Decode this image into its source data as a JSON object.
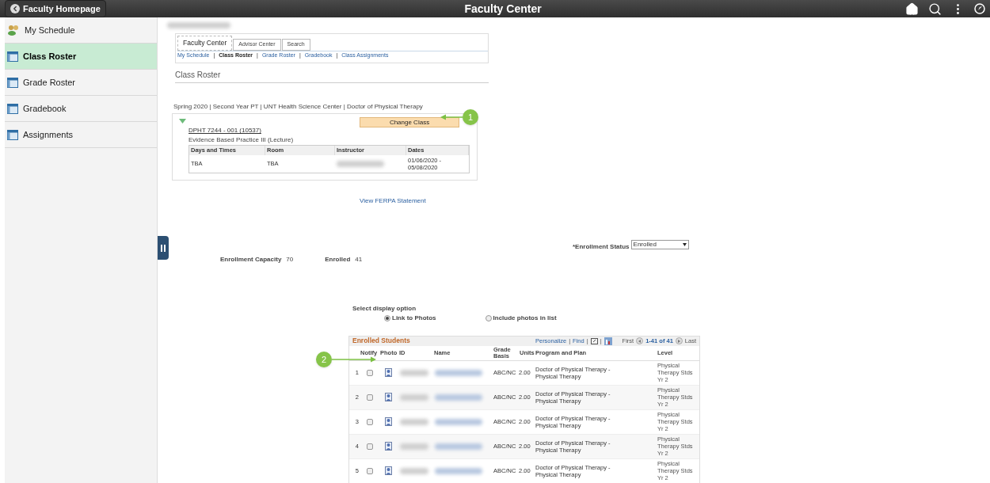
{
  "header": {
    "back_button": "Faculty Homepage",
    "title": "Faculty Center"
  },
  "sidebar": {
    "items": [
      {
        "label": "My Schedule",
        "kind": "schedule",
        "selected": false
      },
      {
        "label": "Class Roster",
        "kind": "page",
        "selected": true
      },
      {
        "label": "Grade Roster",
        "kind": "page",
        "selected": false
      },
      {
        "label": "Gradebook",
        "kind": "page",
        "selected": false
      },
      {
        "label": "Assignments",
        "kind": "page",
        "selected": false
      }
    ]
  },
  "tabs": [
    {
      "label": "Faculty Center",
      "selected": true
    },
    {
      "label": "Advisor Center",
      "selected": false
    },
    {
      "label": "Search",
      "selected": false
    }
  ],
  "subnav": [
    {
      "label": "My Schedule",
      "selected": false
    },
    {
      "label": "Class Roster",
      "selected": true
    },
    {
      "label": "Grade Roster",
      "selected": false
    },
    {
      "label": "Gradebook",
      "selected": false
    },
    {
      "label": "Class Assignments",
      "selected": false
    }
  ],
  "subnav_separator": "|",
  "page_title": "Class Roster",
  "term_line": "Spring 2020 | Second Year PT | UNT Health Science Center | Doctor of Physical Therapy",
  "class": {
    "expanded": true,
    "link": "DPHT 7244 - 001 (10537)",
    "description": "Evidence Based Practice III (Lecture)",
    "change_button": "Change Class",
    "columns": [
      "Days and Times",
      "Room",
      "Instructor",
      "Dates"
    ],
    "rows": [
      {
        "days": "TBA",
        "room": "TBA",
        "dates": "01/06/2020 - 05/08/2020"
      }
    ]
  },
  "ferpa_link": "View FERPA Statement",
  "enrollment": {
    "capacity_label": "Enrollment Capacity",
    "capacity": "70",
    "enrolled_label": "Enrolled",
    "enrolled": "41",
    "status_label": "*Enrollment Status",
    "status_value": "Enrolled"
  },
  "display_option": {
    "label": "Select display option",
    "options": [
      {
        "label": "Link to Photos",
        "selected": true
      },
      {
        "label": "Include photos in list",
        "selected": false
      }
    ]
  },
  "students": {
    "title": "Enrolled Students",
    "tools": [
      "Personalize",
      "Find"
    ],
    "first": "First",
    "range": "1-41 of 41",
    "last": "Last",
    "columns": [
      "Notify",
      "Photo",
      "ID",
      "Name",
      "Grade Basis",
      "Units",
      "Program and Plan",
      "Level"
    ],
    "rows": [
      {
        "number": "1",
        "notify": false,
        "grade_basis": "ABC/NC",
        "units": "2.00",
        "program": "Doctor of Physical Therapy - Physical Therapy",
        "level": "Physical Therapy Stds Yr 2"
      },
      {
        "number": "2",
        "notify": false,
        "grade_basis": "ABC/NC",
        "units": "2.00",
        "program": "Doctor of Physical Therapy - Physical Therapy",
        "level": "Physical Therapy Stds Yr 2"
      },
      {
        "number": "3",
        "notify": false,
        "grade_basis": "ABC/NC",
        "units": "2.00",
        "program": "Doctor of Physical Therapy - Physical Therapy",
        "level": "Physical Therapy Stds Yr 2"
      },
      {
        "number": "4",
        "notify": false,
        "grade_basis": "ABC/NC",
        "units": "2.00",
        "program": "Doctor of Physical Therapy - Physical Therapy",
        "level": "Physical Therapy Stds Yr 2"
      },
      {
        "number": "5",
        "notify": false,
        "grade_basis": "ABC/NC",
        "units": "2.00",
        "program": "Doctor of Physical Therapy - Physical Therapy",
        "level": "Physical Therapy Stds Yr 2"
      }
    ]
  },
  "callouts": [
    "1",
    "2"
  ]
}
